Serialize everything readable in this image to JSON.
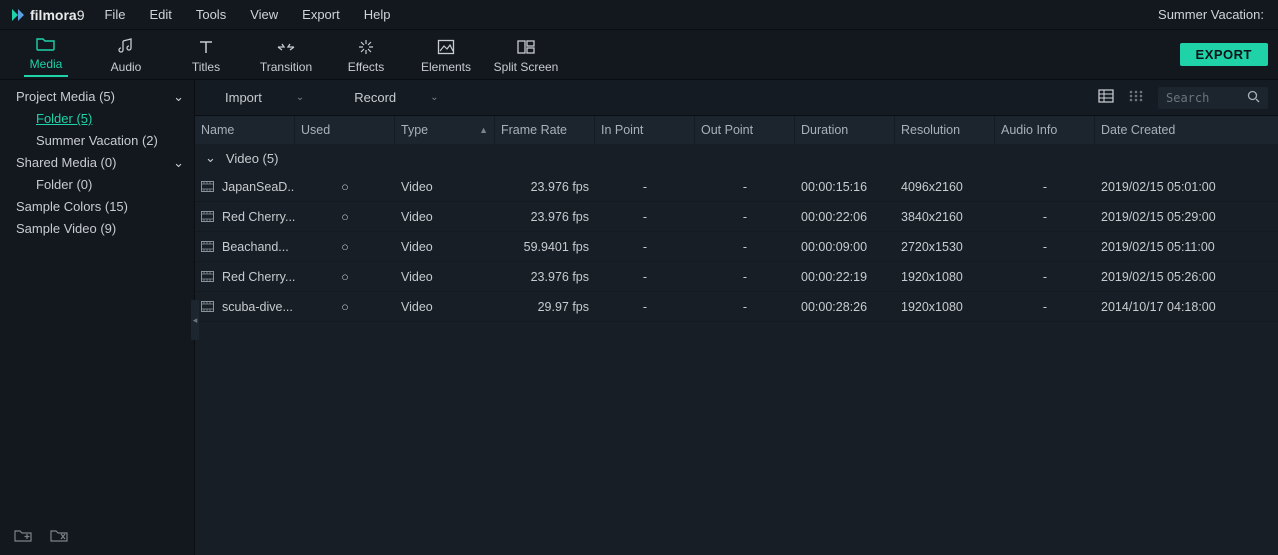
{
  "app": {
    "brand1": "filmora",
    "brand2": "9",
    "project_title": "Summer Vacation:"
  },
  "menu": {
    "file": "File",
    "edit": "Edit",
    "tools": "Tools",
    "view": "View",
    "export": "Export",
    "help": "Help"
  },
  "ribbon": {
    "media": "Media",
    "audio": "Audio",
    "titles": "Titles",
    "transition": "Transition",
    "effects": "Effects",
    "elements": "Elements",
    "split": "Split Screen",
    "export_btn": "EXPORT"
  },
  "sidebar": {
    "items": [
      {
        "label": "Project Media (5)",
        "expandable": true
      },
      {
        "label": "Folder (5)",
        "level": 2,
        "selected": true
      },
      {
        "label": "Summer Vacation (2)",
        "level": 2
      },
      {
        "label": "Shared Media (0)",
        "expandable": true
      },
      {
        "label": "Folder (0)",
        "level": 2
      },
      {
        "label": "Sample Colors (15)"
      },
      {
        "label": "Sample Video (9)"
      }
    ]
  },
  "toolbar": {
    "import": "Import",
    "record": "Record",
    "search_placeholder": "Search"
  },
  "columns": {
    "name": "Name",
    "used": "Used",
    "type": "Type",
    "framerate": "Frame Rate",
    "inpoint": "In Point",
    "outpoint": "Out Point",
    "duration": "Duration",
    "resolution": "Resolution",
    "audio": "Audio Info",
    "date": "Date Created"
  },
  "group": {
    "label": "Video (5)"
  },
  "rows": [
    {
      "name": "JapanSeaD...",
      "used": "○",
      "type": "Video",
      "framerate": "23.976 fps",
      "inpoint": "-",
      "outpoint": "-",
      "duration": "00:00:15:16",
      "resolution": "4096x2160",
      "audio": "-",
      "date": "2019/02/15 05:01:00"
    },
    {
      "name": "Red Cherry...",
      "used": "○",
      "type": "Video",
      "framerate": "23.976 fps",
      "inpoint": "-",
      "outpoint": "-",
      "duration": "00:00:22:06",
      "resolution": "3840x2160",
      "audio": "-",
      "date": "2019/02/15 05:29:00"
    },
    {
      "name": "Beachand...",
      "used": "○",
      "type": "Video",
      "framerate": "59.9401 fps",
      "inpoint": "-",
      "outpoint": "-",
      "duration": "00:00:09:00",
      "resolution": "2720x1530",
      "audio": "-",
      "date": "2019/02/15 05:11:00"
    },
    {
      "name": "Red Cherry...",
      "used": "○",
      "type": "Video",
      "framerate": "23.976 fps",
      "inpoint": "-",
      "outpoint": "-",
      "duration": "00:00:22:19",
      "resolution": "1920x1080",
      "audio": "-",
      "date": "2019/02/15 05:26:00"
    },
    {
      "name": "scuba-dive...",
      "used": "○",
      "type": "Video",
      "framerate": "29.97 fps",
      "inpoint": "-",
      "outpoint": "-",
      "duration": "00:00:28:26",
      "resolution": "1920x1080",
      "audio": "-",
      "date": "2014/10/17 04:18:00"
    }
  ]
}
